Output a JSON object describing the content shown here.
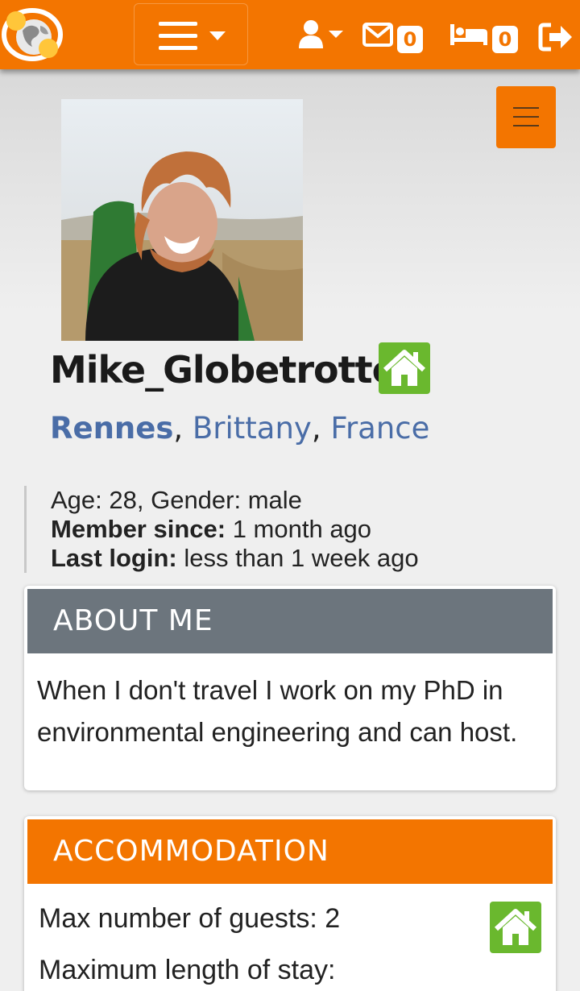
{
  "navbar": {
    "bg_color": "#f37500",
    "logo_icon": "globe-logo-icon",
    "menu_icon": "hamburger-menu-icon",
    "user_icon": "user-icon",
    "messages_icon": "envelope-icon",
    "messages_count": "0",
    "requests_icon": "bed-icon",
    "requests_count": "0",
    "logout_icon": "logout-icon"
  },
  "profile": {
    "username": "Mike_Globetrotter",
    "host_status_icon": "house-icon",
    "location": {
      "city": "Rennes",
      "region": "Brittany",
      "country": "France",
      "separator": ","
    },
    "age_gender": "Age: 28, Gender: male",
    "member_since_label": "Member since:",
    "member_since_value": " 1 month ago",
    "last_login_label": "Last login:",
    "last_login_value": " less than 1 week ago"
  },
  "about": {
    "title": "ABOUT ME",
    "text": "When I don't travel I work on my PhD in environmental engineering and can host."
  },
  "accommodation": {
    "title": "ACCOMMODATION",
    "max_guests": "Max number of guests: 2",
    "max_stay": "Maximum length of stay:",
    "status_icon": "house-icon"
  },
  "colors": {
    "brand_orange": "#f37500",
    "host_green": "#6ab82e",
    "link_blue": "#4a6da7",
    "card_header_grey": "#6c757d"
  }
}
